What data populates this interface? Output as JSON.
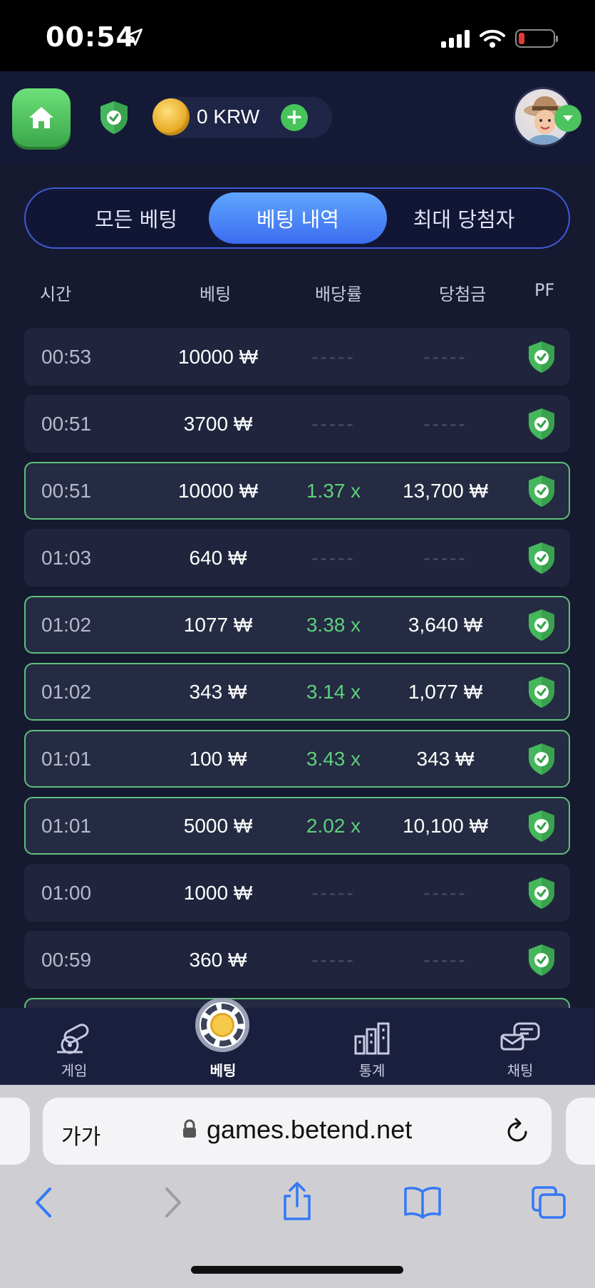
{
  "status_bar": {
    "time": "00:54"
  },
  "header": {
    "balance": "0 KRW",
    "add_label": "+"
  },
  "tabs": [
    {
      "label": "모든 베팅",
      "active": false
    },
    {
      "label": "베팅 내역",
      "active": true
    },
    {
      "label": "최대 당첨자",
      "active": false
    }
  ],
  "table": {
    "columns": [
      "시간",
      "베팅",
      "배당률",
      "당첨금",
      "PF"
    ],
    "rows": [
      {
        "time": "00:53",
        "bet": "10000 ₩",
        "multiplier": "-----",
        "payout": "-----",
        "win": false
      },
      {
        "time": "00:51",
        "bet": "3700 ₩",
        "multiplier": "-----",
        "payout": "-----",
        "win": false
      },
      {
        "time": "00:51",
        "bet": "10000 ₩",
        "multiplier": "1.37 x",
        "payout": "13,700 ₩",
        "win": true
      },
      {
        "time": "01:03",
        "bet": "640 ₩",
        "multiplier": "-----",
        "payout": "-----",
        "win": false
      },
      {
        "time": "01:02",
        "bet": "1077 ₩",
        "multiplier": "3.38 x",
        "payout": "3,640 ₩",
        "win": true
      },
      {
        "time": "01:02",
        "bet": "343 ₩",
        "multiplier": "3.14 x",
        "payout": "1,077 ₩",
        "win": true
      },
      {
        "time": "01:01",
        "bet": "100 ₩",
        "multiplier": "3.43 x",
        "payout": "343 ₩",
        "win": true
      },
      {
        "time": "01:01",
        "bet": "5000 ₩",
        "multiplier": "2.02 x",
        "payout": "10,100 ₩",
        "win": true
      },
      {
        "time": "01:00",
        "bet": "1000 ₩",
        "multiplier": "-----",
        "payout": "-----",
        "win": false
      },
      {
        "time": "00:59",
        "bet": "360 ₩",
        "multiplier": "-----",
        "payout": "-----",
        "win": false
      },
      {
        "time": "",
        "bet": "",
        "multiplier": "",
        "payout": "",
        "win": true
      }
    ]
  },
  "bottom_nav": [
    {
      "label": "게임",
      "icon": "cannon-icon",
      "active": false
    },
    {
      "label": "베팅",
      "icon": "chip-icon",
      "active": true
    },
    {
      "label": "통계",
      "icon": "stats-buildings-icon",
      "active": false
    },
    {
      "label": "채팅",
      "icon": "chat-icon",
      "active": false
    }
  ],
  "browser": {
    "text_size_label": "가가",
    "url": "games.betend.net"
  },
  "colors": {
    "accent_blue": "#3c6cf0",
    "win_green": "#5fcf7c",
    "background": "#161a30"
  }
}
